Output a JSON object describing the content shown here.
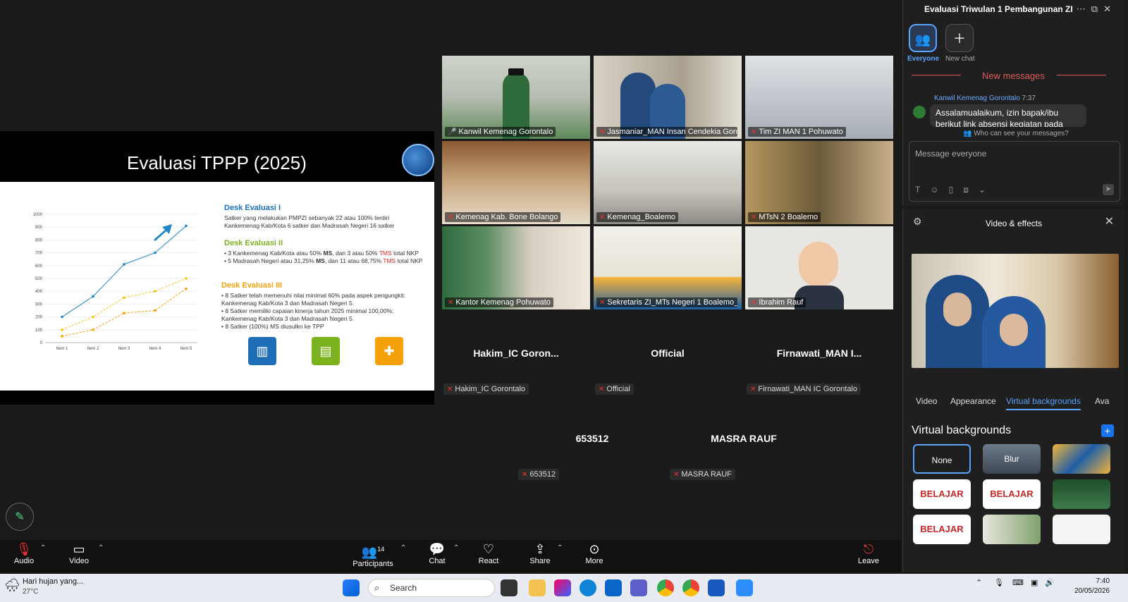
{
  "shared_screen": {
    "slide_title": "Evaluasi TPPP (2025)",
    "chart": {
      "y_ticks": [
        "1000",
        "900",
        "800",
        "700",
        "600",
        "500",
        "400",
        "300",
        "200",
        "100",
        "0"
      ],
      "x_ticks": [
        "Item 1",
        "Item 2",
        "Item 3",
        "Item 4",
        "Item 5"
      ]
    },
    "desk1": {
      "heading": "Desk Evaluasi I",
      "text": "Satker yang melakukan PMPZI sebanyak 22 atau 100% terdiri Kankemenag Kab/Kota 6 satker dan Madrasah Negeri 16 satker"
    },
    "desk2": {
      "heading": "Desk Evaluasi II",
      "item1_a": "3 Kankemenag Kab/Kota atau 50% ",
      "item1_ms": "MS",
      "item1_b": ", dan 3 atau 50% ",
      "item1_tms": "TMS",
      "item1_c": " total NKP",
      "item2_a": "5 Madrasah Negeri atau 31,25% ",
      "item2_ms": "MS",
      "item2_b": ", dan 11 atau 68,75% ",
      "item2_tms": "TMS",
      "item2_c": " total NKP"
    },
    "desk3": {
      "heading": "Desk Evaluasi III",
      "items": [
        "8 Satker telah memenuhi nilai minimal 60% pada aspek pengungkit: Kankemenag Kab/Kota 3 dan Madrasah Negeri 5.",
        "8 Satker memiliki capaian kinerja tahun 2025 minimal 100,00%: Kankemenag Kab/Kota 3 dan Madrasah Negeri 5.",
        "8 Satker (100%) MS diusulkn ke TPP"
      ]
    }
  },
  "chart_data": {
    "type": "line",
    "categories": [
      "Item 1",
      "Item 2",
      "Item 3",
      "Item 4",
      "Item 5"
    ],
    "series": [
      {
        "values": [
          200,
          360,
          610,
          700,
          910
        ],
        "color": "#1e88c7"
      },
      {
        "values": [
          100,
          200,
          350,
          400,
          500
        ],
        "color": "#f4c518"
      },
      {
        "values": [
          50,
          100,
          230,
          250,
          420
        ],
        "color": "#f4a10c"
      }
    ],
    "ylim": [
      0,
      1000
    ]
  },
  "participants_video": [
    {
      "name": "Kanwil Kemenag Gorontalo"
    },
    {
      "name": "Jasmaniar_MAN Insan Cendekia Goro..."
    },
    {
      "name": "Tim ZI MAN 1 Pohuwato"
    },
    {
      "name": "Kemenag Kab. Bone Bolango"
    },
    {
      "name": "Kemenag_Boalemo"
    },
    {
      "name": "MTsN 2 Boalemo"
    },
    {
      "name": "Kantor Kemenag Pohuwato"
    },
    {
      "name": "Sekretaris ZI_MTs Negeri 1 Boalemo_..."
    },
    {
      "name": "Ibrahim Rauf"
    }
  ],
  "participants_no_video": [
    {
      "display": "Hakim_IC  Goron...",
      "badge": "Hakim_IC Gorontalo"
    },
    {
      "display": "Official",
      "badge": "Official"
    },
    {
      "display": "Firnawati_MAN  I...",
      "badge": "Firnawati_MAN IC Gorontalo"
    },
    {
      "display": "653512",
      "badge": "653512"
    },
    {
      "display": "MASRA RAUF",
      "badge": "MASRA RAUF"
    }
  ],
  "chat": {
    "title": "Evaluasi Triwulan 1 Pembangunan ZI",
    "tab_everyone": "Everyone",
    "tab_new_chat": "New chat",
    "new_messages": "New messages",
    "sender": "Kanwil Kemenag Gorontalo",
    "time": "7:37",
    "message": "Assalamualaikum, izin bapak/ibu berikut link absensi kegiatan pada",
    "who_can_see": "Who can see your messages?",
    "placeholder": "Message everyone"
  },
  "effects": {
    "title": "Video & effects",
    "tabs": [
      "Video",
      "Appearance",
      "Virtual backgrounds",
      "Ava"
    ],
    "section_title": "Virtual backgrounds",
    "none_label": "None",
    "blur_label": "Blur",
    "thumb_text": "BELAJAR"
  },
  "toolbar": {
    "audio": "Audio",
    "video": "Video",
    "participants": "Participants",
    "participants_count": "14",
    "chat": "Chat",
    "react": "React",
    "share": "Share",
    "more": "More",
    "leave": "Leave"
  },
  "taskbar": {
    "weather_text": "Hari hujan yang...",
    "weather_temp": "27°C",
    "search_label": "Search",
    "time": "7:40",
    "date": "20/05/2026"
  },
  "colors": {
    "accent": "#5aa3ff",
    "active_speaker": "#4ade80",
    "new_messages": "#e05a5a",
    "leave": "#e33b3b"
  }
}
